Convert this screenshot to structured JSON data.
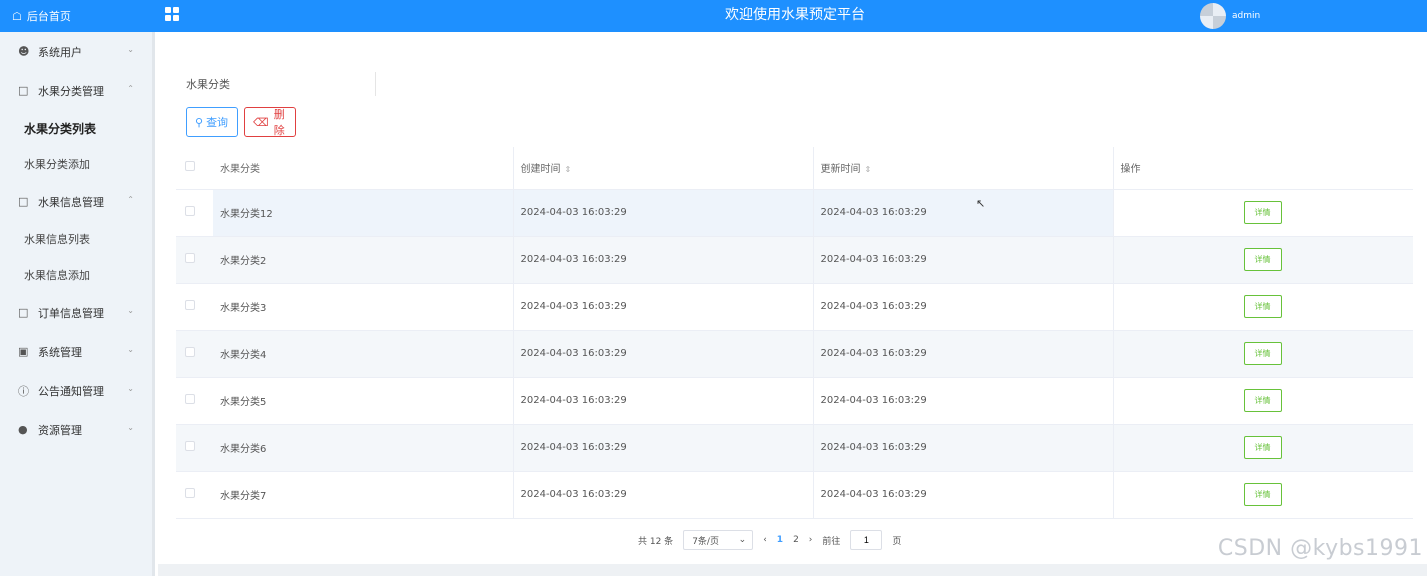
{
  "topbar": {
    "brand": "后台首页",
    "title": "欢迎使用水果预定平台",
    "user": "admin"
  },
  "sidebar": {
    "items": [
      {
        "label": "系统用户",
        "icon": "user-icon",
        "expanded": false
      },
      {
        "label": "水果分类管理",
        "icon": "folder-icon",
        "expanded": true,
        "children": [
          "水果分类列表",
          "水果分类添加"
        ]
      },
      {
        "label": "水果信息管理",
        "icon": "folder-icon",
        "expanded": true,
        "children": [
          "水果信息列表",
          "水果信息添加"
        ]
      },
      {
        "label": "订单信息管理",
        "icon": "folder-icon",
        "expanded": false
      },
      {
        "label": "系统管理",
        "icon": "image-icon",
        "expanded": false
      },
      {
        "label": "公告通知管理",
        "icon": "info-icon",
        "expanded": false
      },
      {
        "label": "资源管理",
        "icon": "location-icon",
        "expanded": false
      }
    ],
    "active": "水果分类列表"
  },
  "search": {
    "label": "水果分类",
    "value": ""
  },
  "buttons": {
    "query": "查询",
    "delete": "删除"
  },
  "table": {
    "headers": [
      "水果分类",
      "创建时间",
      "更新时间",
      "操作"
    ],
    "rows": [
      {
        "name": "水果分类12",
        "created": "2024-04-03 16:03:29",
        "updated": "2024-04-03 16:03:29"
      },
      {
        "name": "水果分类2",
        "created": "2024-04-03 16:03:29",
        "updated": "2024-04-03 16:03:29"
      },
      {
        "name": "水果分类3",
        "created": "2024-04-03 16:03:29",
        "updated": "2024-04-03 16:03:29"
      },
      {
        "name": "水果分类4",
        "created": "2024-04-03 16:03:29",
        "updated": "2024-04-03 16:03:29"
      },
      {
        "name": "水果分类5",
        "created": "2024-04-03 16:03:29",
        "updated": "2024-04-03 16:03:29"
      },
      {
        "name": "水果分类6",
        "created": "2024-04-03 16:03:29",
        "updated": "2024-04-03 16:03:29"
      },
      {
        "name": "水果分类7",
        "created": "2024-04-03 16:03:29",
        "updated": "2024-04-03 16:03:29"
      }
    ],
    "action_label": "详情"
  },
  "pager": {
    "total": "共 12 条",
    "page_size": "7条/页",
    "pages": [
      "1",
      "2"
    ],
    "current": "1",
    "goto_label": "前往",
    "goto_value": "1",
    "page_unit": "页"
  },
  "watermark": "CSDN @kybs1991",
  "colors": {
    "primary": "#1e90ff",
    "danger": "#e04040",
    "success": "#67c23a",
    "sidebar_bg": "#eef3f8"
  }
}
